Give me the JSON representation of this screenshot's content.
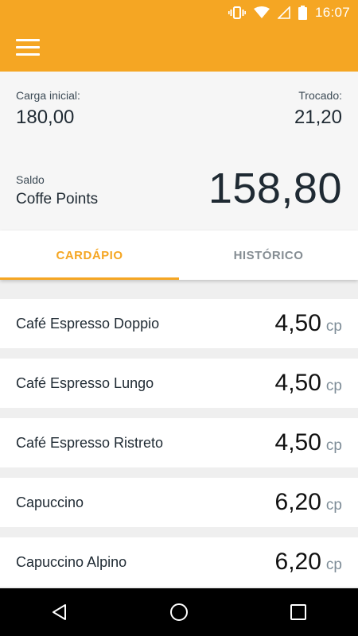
{
  "status_bar": {
    "time": "16:07",
    "icons": [
      "vibrate-icon",
      "wifi-icon",
      "signal-icon",
      "battery-icon"
    ]
  },
  "app_bar": {
    "menu_icon": "hamburger-menu-icon",
    "background_color": "#f5a623"
  },
  "summary": {
    "initial_charge_label": "Carga inicial:",
    "initial_charge_value": "180,00",
    "traded_label": "Trocado:",
    "traded_value": "21,20",
    "balance_label": "Saldo",
    "balance_name": "Coffe Points",
    "balance_value": "158,80"
  },
  "tabs": [
    {
      "label": "CARDÁPIO",
      "active": true
    },
    {
      "label": "HISTÓRICO",
      "active": false
    }
  ],
  "menu_items": [
    {
      "name": "Café Espresso Doppio",
      "price": "4,50",
      "unit": "cp"
    },
    {
      "name": "Café Espresso Lungo",
      "price": "4,50",
      "unit": "cp"
    },
    {
      "name": "Café Espresso Ristreto",
      "price": "4,50",
      "unit": "cp"
    },
    {
      "name": "Capuccino",
      "price": "6,20",
      "unit": "cp"
    },
    {
      "name": "Capuccino Alpino",
      "price": "6,20",
      "unit": "cp"
    }
  ],
  "nav_bar": {
    "buttons": [
      "back-icon",
      "home-icon",
      "recents-icon"
    ]
  },
  "colors": {
    "accent": "#f5a623",
    "unit_text": "#7e8d98",
    "inactive_tab": "#858d93"
  }
}
